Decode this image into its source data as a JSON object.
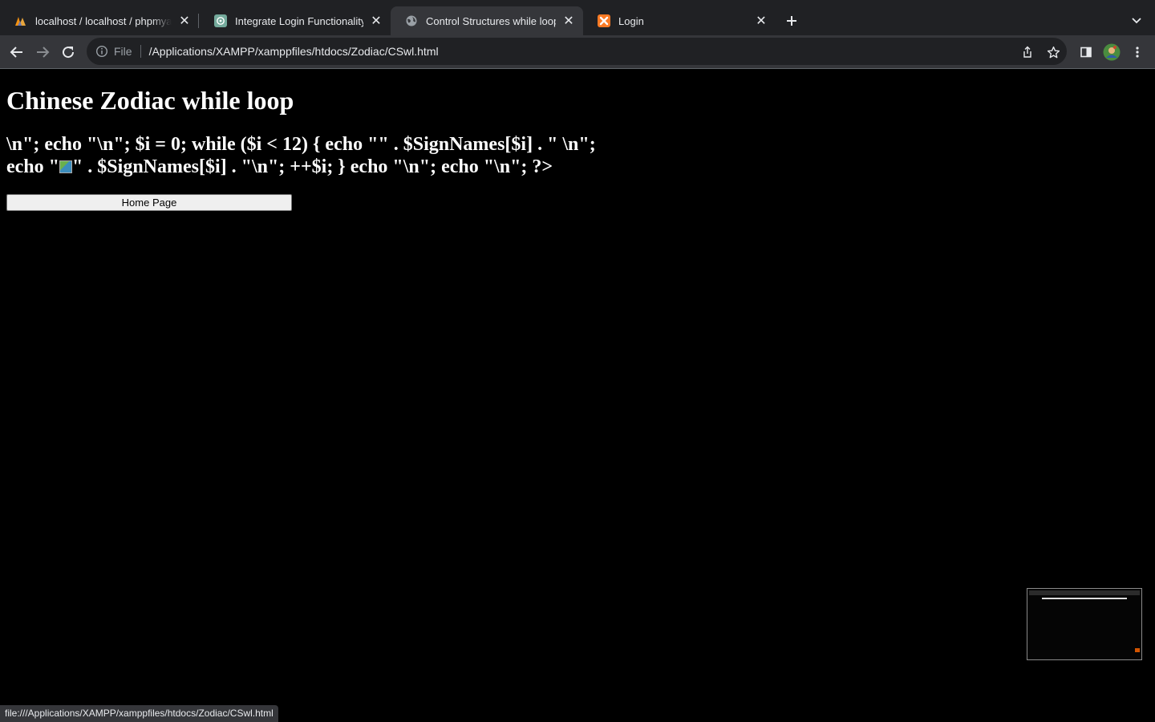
{
  "browser": {
    "tabs": [
      {
        "title": "localhost / localhost / phpmyadmin",
        "icon": "phpmyadmin-icon",
        "active": false
      },
      {
        "title": "Integrate Login Functionality",
        "icon": "chatgpt-icon",
        "active": false
      },
      {
        "title": "Control Structures while loop",
        "icon": "globe-icon",
        "active": true
      },
      {
        "title": "Login",
        "icon": "xampp-icon",
        "active": false
      }
    ],
    "address": {
      "scheme_label": "File",
      "url": "/Applications/XAMPP/xamppfiles/htdocs/Zodiac/CSwl.html"
    },
    "status_url": "file:///Applications/XAMPP/xamppfiles/htdocs/Zodiac/CSwl.html"
  },
  "page": {
    "heading": "Chinese Zodiac while loop",
    "code_text_before_image": "\\n\"; echo \"\\n\"; $i = 0; while ($i < 12) { echo \"\" . $SignNames[$i] . \" \\n\"; echo \"",
    "code_text_after_image": "\" . $SignNames[$i] . \"\\n\"; ++$i; } echo \"\\n\"; echo \"\\n\"; ?>",
    "home_button_label": "Home Page"
  },
  "colors": {
    "page_background": "#000000",
    "page_text": "#ffffff",
    "tabstrip": "#202124",
    "toolbar": "#35363a"
  }
}
